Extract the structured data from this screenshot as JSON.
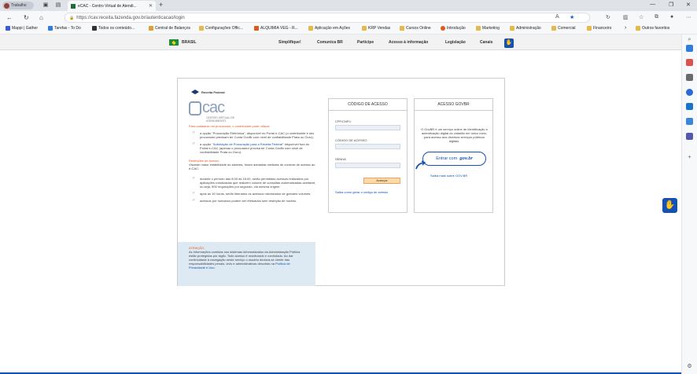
{
  "browser": {
    "profile_label": "Trabalho",
    "tab_title": "eCAC - Centro Virtual de Atendi...",
    "url": "https://cav.receita.fazenda.gov.br/autenticacao/login",
    "favorites": [
      {
        "label": "Mappi | Gather",
        "color": "#3b5bdb"
      },
      {
        "label": "Tarefas - To Do",
        "color": "#2b7de9"
      },
      {
        "label": "Todos os conteúdo...",
        "color": "#333333"
      },
      {
        "label": "Central de Balanços",
        "color": "#e0a030"
      },
      {
        "label": "Configurações Offic...",
        "color": "#e8b84a"
      },
      {
        "label": "ALQUIMIA VEG - R...",
        "color": "#e05a1c"
      },
      {
        "label": "Aplicação em Ações",
        "color": "#e8b84a"
      },
      {
        "label": "KRP Vendas",
        "color": "#e8b84a"
      },
      {
        "label": "Cursos Online",
        "color": "#e8b84a"
      },
      {
        "label": "Introdução",
        "color": "#e05a1c"
      },
      {
        "label": "Marketing",
        "color": "#e8b84a"
      },
      {
        "label": "Administração",
        "color": "#e8b84a"
      },
      {
        "label": "Comercial",
        "color": "#e8b84a"
      },
      {
        "label": "Financeiro",
        "color": "#e8b84a"
      },
      {
        "label": "Outros favoritos",
        "color": "#e8b84a"
      }
    ]
  },
  "govbar": {
    "brasil": "BRASIL",
    "links": [
      "Simplifique!",
      "Comunica BR",
      "Participe",
      "Acesso à informação",
      "Legislação",
      "Canais"
    ]
  },
  "logo": {
    "rf": "Receita Federal",
    "ecac": "cac",
    "sub": "CENTRO VIRTUAL DE ATENDIMENTO"
  },
  "info": {
    "header1": "Para cadastrar um procurador, o contribuinte pode utilizar:",
    "b1": "a opção \"Procuração Eletrônica\", disponível no Portal e-CAC (o contribuinte e seu procurador precisam ter Conta GovBr com nível de confiabilidade Prata ou Ouro);",
    "b2a": "a opção \"",
    "b2link": "Solicitação de Procuração para a Receita Federal",
    "b2b": "\" disponível fora do Portal e-CAC (apenas o procurador precisa ter Conta GovBr com nível de confiabilidade Prata ou Ouro).",
    "header2": "Restrições de Acesso",
    "p2": "Visando maior estabilidade do sistema, foram adotadas medidas de controle de acesso ao e-CAC:",
    "b3": "durante o período das 8:00 às 16:00, serão permitidos acessos realizados por aplicações robotizadas que realizem volume de consultas automatizadas aceitável, ou seja, 500 requisições por segundo, via mesma origem.",
    "b4": "após as 16 horas, serão liberados os acessos robotizados de grandes volumes.",
    "b5": "acessos por humanos podem ser efetuados sem restrição de horário."
  },
  "warning": {
    "title": "ATENÇÃO:",
    "text": "As informações contidas nos sistemas informatizados da Administração Pública estão protegidas por sigilo. Todo acesso é monitorado e controlado. Ao dar continuidade à navegação neste serviço o usuário declara-se ciente das responsabilidades penais, civis e administrativas descritas na ",
    "link": "Política de Privacidade e Uso",
    "end": "."
  },
  "login": {
    "title": "CÓDIGO DE ACESSO",
    "cpf_label": "CPF/CNPJ:",
    "code_label": "CÓDIGO DE ACESSO",
    "pwd_label": "SENHA",
    "submit": "Avançar",
    "help_link": "Saiba como gerar o código de acesso"
  },
  "govbr": {
    "title": "ACESSO GOVBR",
    "text": "O GovBR é um serviço online de identificação e autenticação digital do cidadão em único meio, para acesso aos diversos serviços públicos digitais.",
    "btn_label": "Entrar com",
    "btn_brand": "gov.br",
    "more_link": "Saiba mais sobre GOV.BR"
  }
}
